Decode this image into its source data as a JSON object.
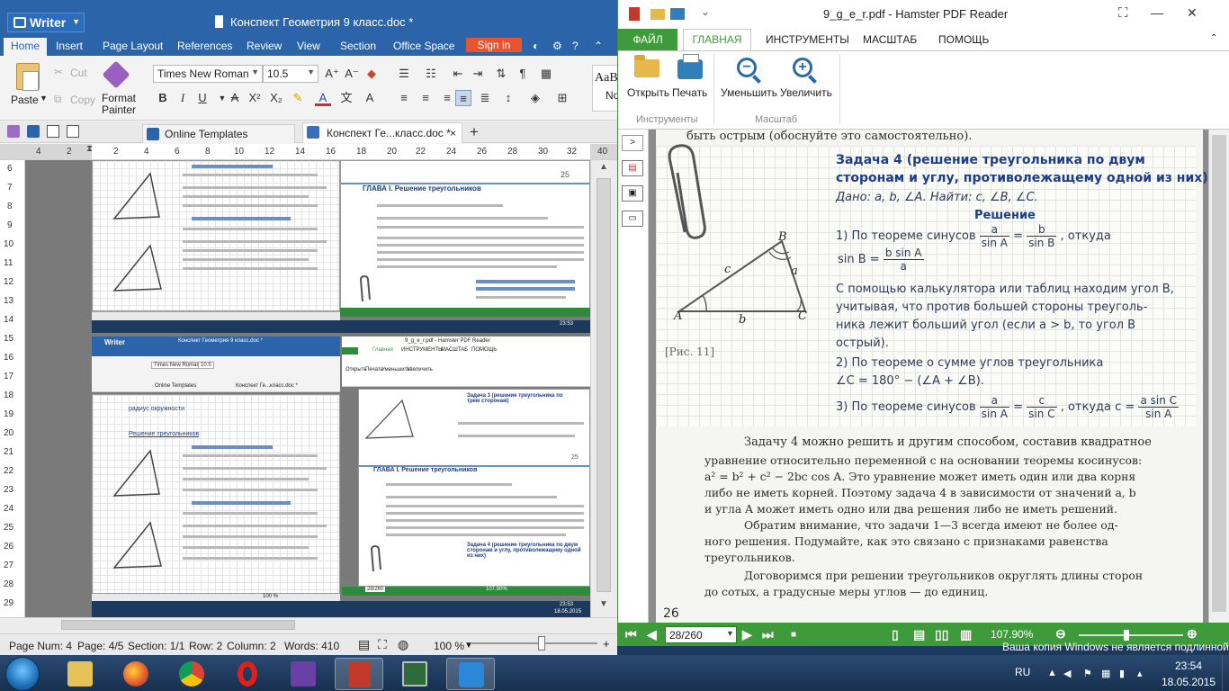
{
  "writer": {
    "app_name": "Writer",
    "doc_title": "Конспект Геометрия 9 класс.doc *",
    "menu": [
      "Home",
      "Insert",
      "Page Layout",
      "References",
      "Review",
      "View",
      "Section",
      "Office Space"
    ],
    "signin": "Sign in",
    "ribbon": {
      "paste": "Paste",
      "cut": "Cut",
      "copy": "Copy",
      "format_painter_1": "Format",
      "format_painter_2": "Painter",
      "font_name": "Times New Roman",
      "font_size": "10.5",
      "style_preview_1": "AaB",
      "style_preview_2": "No"
    },
    "tabs": {
      "online": "Online Templates",
      "doc": "Конспект Ге...класс.doc *"
    },
    "ruler_numbers": [
      "4",
      "2",
      "2",
      "4",
      "6",
      "8",
      "10",
      "12",
      "14",
      "16",
      "18",
      "20",
      "22",
      "24",
      "26",
      "28",
      "30",
      "32",
      "34",
      "36",
      "38",
      "40"
    ],
    "vruler_numbers": [
      "6",
      "7",
      "8",
      "9",
      "10",
      "11",
      "12",
      "13",
      "14",
      "15",
      "16",
      "17",
      "18",
      "19",
      "20",
      "21",
      "22",
      "23",
      "24",
      "25",
      "26",
      "27",
      "28",
      "29"
    ],
    "status": {
      "page_num": "Page Num: 4",
      "page": "Page: 4/5",
      "section": "Section: 1/1",
      "row": "Row: 2",
      "column": "Column: 2",
      "words": "Words: 410",
      "zoom": "100 %"
    },
    "nested": {
      "writer_label": "Writer",
      "doc_title": "Конспект Геометрия 9 класс.doc *",
      "pdf_title": "9_g_e_r.pdf - Hamster PDF Reader",
      "font_name": "Times New Roman",
      "font_size": "10.5",
      "online": "Online Templates",
      "doc_tab": "Конспект Ге...класс.doc *",
      "heading_radius": "радиус окружности",
      "heading_solve": "Решение треугольников",
      "chapter": "ГЛАВА I. Решение треугольников",
      "page_25": "25",
      "pdf_page": "28/260",
      "pdf_zoom": "107.90%",
      "time": "23:53",
      "date": "18.05.2015",
      "zoom": "100 %",
      "pdf_menu": [
        "Главная",
        "ИНСТРУМЕНТЫ",
        "МАСШТАБ",
        "ПОМОЩЬ"
      ],
      "pdf_tools": [
        "Открыть",
        "Печать",
        "Уменьшить",
        "Увеличить"
      ],
      "task3": "Задача 3 (решение треугольника по трем сторонам)",
      "task4": "Задача 4 (решение треугольника по двум сторонам и углу, противолежащему одной из них)"
    }
  },
  "pdf": {
    "title": "9_g_e_r.pdf - Hamster PDF Reader",
    "tabs": {
      "file": "ФАЙЛ",
      "home": "ГЛАВНАЯ",
      "tools": "ИНСТРУМЕНТЫ",
      "scale": "МАСШТАБ",
      "help": "ПОМОЩЬ"
    },
    "ribbon": {
      "open": "Открыть",
      "print": "Печать",
      "zoom_out": "Уменьшить",
      "zoom_in": "Увеличить",
      "group_tools": "Инструменты",
      "group_scale": "Масштаб"
    },
    "page": {
      "top_line": "быть острым (обоснуйте это самостоятельно).",
      "task_title_1": "Задача 4 (решение треугольника по двум",
      "task_title_2": "сторонам и углу, противолежащему одной из них)",
      "given": "Дано: a, b, ∠A. Найти: c, ∠B, ∠C.",
      "solution": "Решение",
      "step1_pre": "1) По теореме синусов",
      "step1_post": ", откуда",
      "sinB_pre": "sin B =",
      "frac_a": "a",
      "frac_sinA": "sin A",
      "frac_b": "b",
      "frac_sinB": "sin B",
      "frac_bsinA": "b sin A",
      "line_calc1": "С помощью калькулятора или таблиц находим угол B,",
      "line_calc2": "учитывая, что против большей стороны треуголь-",
      "line_calc3": "ника лежит больший угол (если a > b, то угол B",
      "line_calc4": "острый).",
      "step2_a": "2) По теореме о сумме углов треугольника",
      "step2_b": "∠C = 180° − (∠A + ∠B).",
      "step3_pre": "3) По теореме синусов",
      "step3_mid": ", откуда c =",
      "frac_c": "c",
      "frac_sinC": "sin C",
      "frac_asinC": "a sin C",
      "fig_label": "[Рис. 11]",
      "label_A": "A",
      "label_B": "B",
      "label_C": "C",
      "label_a": "a",
      "label_b": "b",
      "label_c": "c",
      "para1_l1": "Задачу 4 можно решить и другим способом, составив квадратное",
      "para1_l2": "уравнение относительно переменной c на основании теоремы косинусов:",
      "para1_l3": "a² = b² + c² − 2bc cos A. Это уравнение может иметь один или два корня",
      "para1_l4": "либо не иметь корней. Поэтому задача 4 в зависимости от значений a, b",
      "para1_l5": "и угла A может иметь одно или два решения либо не иметь решений.",
      "para2_l1": "Обратим внимание, что задачи 1—3 всегда имеют не более од-",
      "para2_l2": "ного решения. Подумайте, как это связано с признаками равенства",
      "para2_l3": "треугольников.",
      "para3_l1": "Договоримся при решении треугольников округлять длины сторон",
      "para3_l2": "до сотых, а градусные меры углов — до единиц.",
      "page_number": "26"
    },
    "status": {
      "page_input": "28/260",
      "zoom": "107.90%"
    }
  },
  "watermark": "Ваша копия Windows не является подлинной",
  "taskbar": {
    "lang": "RU",
    "time": "23:54",
    "date": "18.05.2015"
  },
  "colors": {
    "writer_blue": "#2b64a8",
    "pdf_green": "#3f9a3a",
    "signin_orange": "#e8542e"
  }
}
